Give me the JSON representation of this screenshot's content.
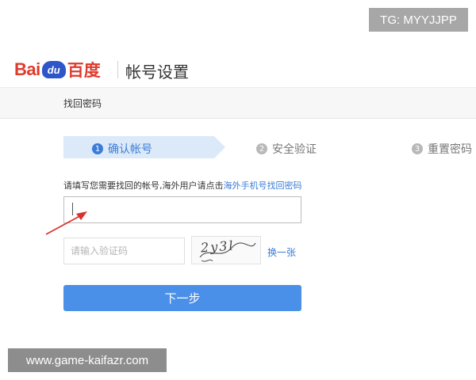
{
  "watermark_top": "TG: MYYJJPP",
  "header": {
    "logo_bai": "Bai",
    "logo_du": "du",
    "logo_cn": "百度",
    "title": "帐号设置"
  },
  "titlebar": {
    "text": "找回密码"
  },
  "steps": [
    {
      "num": "1",
      "label": "确认帐号",
      "state": "active"
    },
    {
      "num": "2",
      "label": "安全验证",
      "state": "inactive"
    },
    {
      "num": "3",
      "label": "重置密码",
      "state": "inactive"
    }
  ],
  "hint": {
    "text": "请填写您需要找回的帐号,海外用户请点击",
    "link": "海外手机号找回密码"
  },
  "account_input": {
    "value": "",
    "placeholder": ""
  },
  "captcha": {
    "placeholder": "请输入验证码",
    "image_text": "2y3l",
    "refresh_label": "换一张"
  },
  "next_button": {
    "label": "下一步"
  },
  "watermark_bottom": "www.game-kaifazr.com",
  "colors": {
    "accent": "#4a90e8",
    "link": "#3b7cd9",
    "brand_red": "#de3b2c",
    "annotation_arrow": "#d9312b"
  }
}
